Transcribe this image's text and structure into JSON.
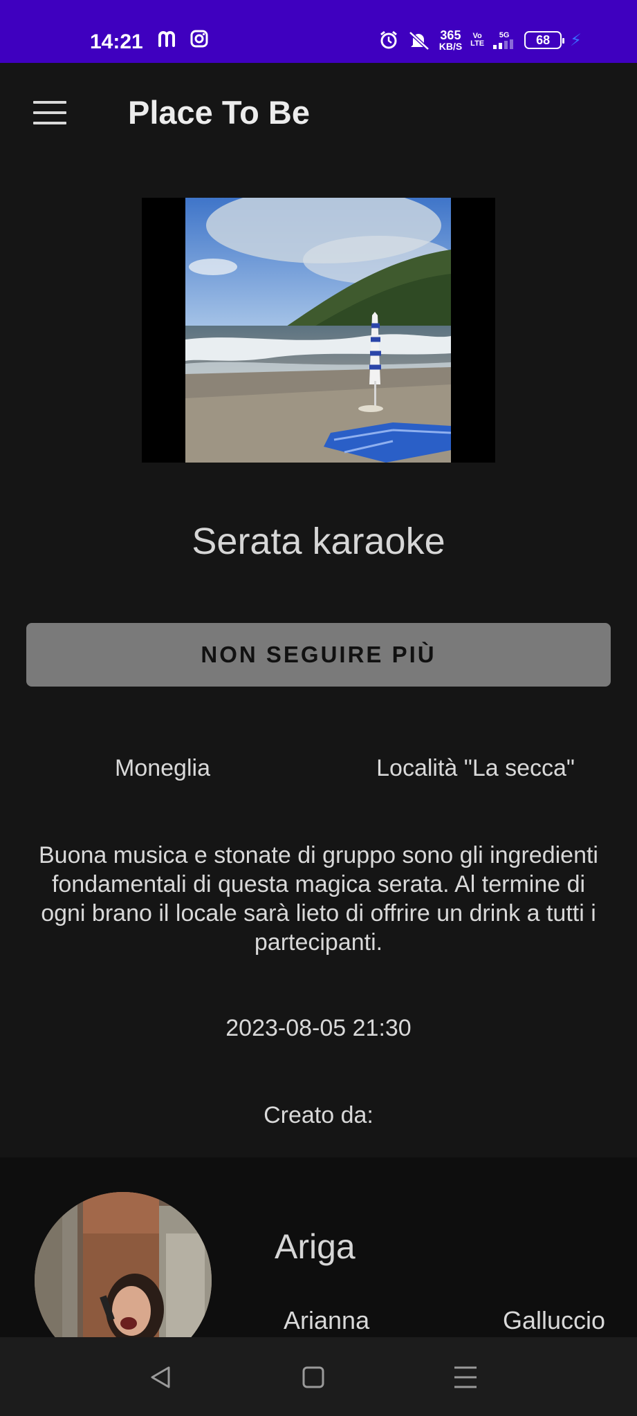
{
  "status_bar": {
    "time": "14:21",
    "left_icons": [
      "m-app-icon",
      "instagram-icon"
    ],
    "speed_value": "365",
    "speed_unit": "KB/S",
    "volte_top": "Vo",
    "volte_bottom": "LTE",
    "network": "5G",
    "battery": "68",
    "right_icons": [
      "alarm-icon",
      "mute-icon",
      "signal-icon",
      "charging-icon"
    ]
  },
  "app_bar": {
    "title": "Place To Be",
    "menu_icon": "hamburger-menu-icon"
  },
  "event": {
    "title": "Serata karaoke",
    "follow_button_label": "NON SEGUIRE PIÙ",
    "city": "Moneglia",
    "place": "Località \"La secca\"",
    "description": "Buona musica e stonate di gruppo sono gli ingredienti fondamentali di questa magica serata. Al termine di ogni brano il locale sarà lieto di offrire un drink a tutti i partecipanti.",
    "datetime": "2023-08-05 21:30",
    "created_by_label": "Creato da:"
  },
  "creator": {
    "username": "Ariga",
    "first_name": "Arianna",
    "last_name": "Galluccio"
  },
  "nav_bar": {
    "icons": [
      "back-triangle-icon",
      "home-square-icon",
      "recents-menu-icon"
    ]
  },
  "colors": {
    "status_bar": "#3f00bf",
    "background": "#151515",
    "button": "#7a7a7a",
    "charging": "#3b6cff"
  }
}
